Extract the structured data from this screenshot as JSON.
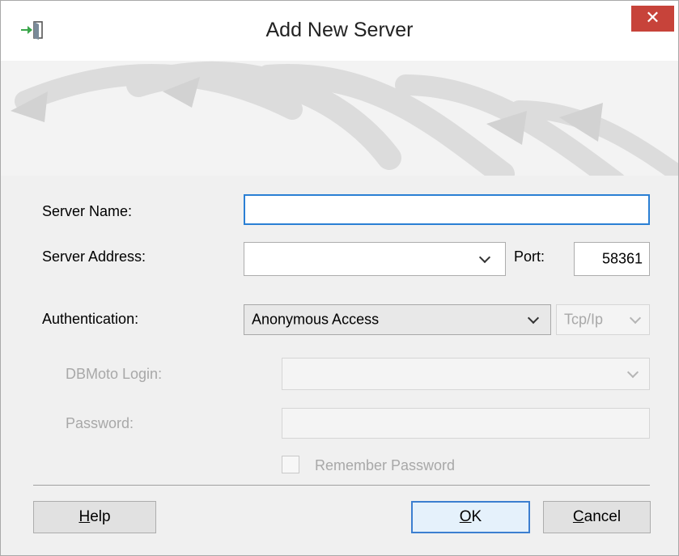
{
  "window": {
    "title": "Add New Server"
  },
  "titlebar": {
    "app_icon": "server-connect-icon",
    "close_glyph": "✕"
  },
  "form": {
    "server_name_label": "Server Name:",
    "server_name_value": "",
    "server_address_label": "Server Address:",
    "server_address_value": "",
    "port_label": "Port:",
    "port_value": "58361",
    "authentication_label": "Authentication:",
    "authentication_value": "Anonymous Access",
    "protocol_value": "Tcp/Ip",
    "dbmoto_login_label": "DBMoto Login:",
    "dbmoto_login_value": "",
    "password_label": "Password:",
    "password_value": "",
    "remember_password_label": "Remember Password",
    "remember_password_checked": false
  },
  "buttons": {
    "help": {
      "underline": "H",
      "rest": "elp"
    },
    "ok": {
      "underline": "O",
      "rest": "K"
    },
    "cancel": {
      "underline": "C",
      "rest": "ancel"
    }
  },
  "colors": {
    "close_button": "#c7433a",
    "focus_border": "#2a7fd4",
    "disabled_text": "#a8a8a8"
  }
}
